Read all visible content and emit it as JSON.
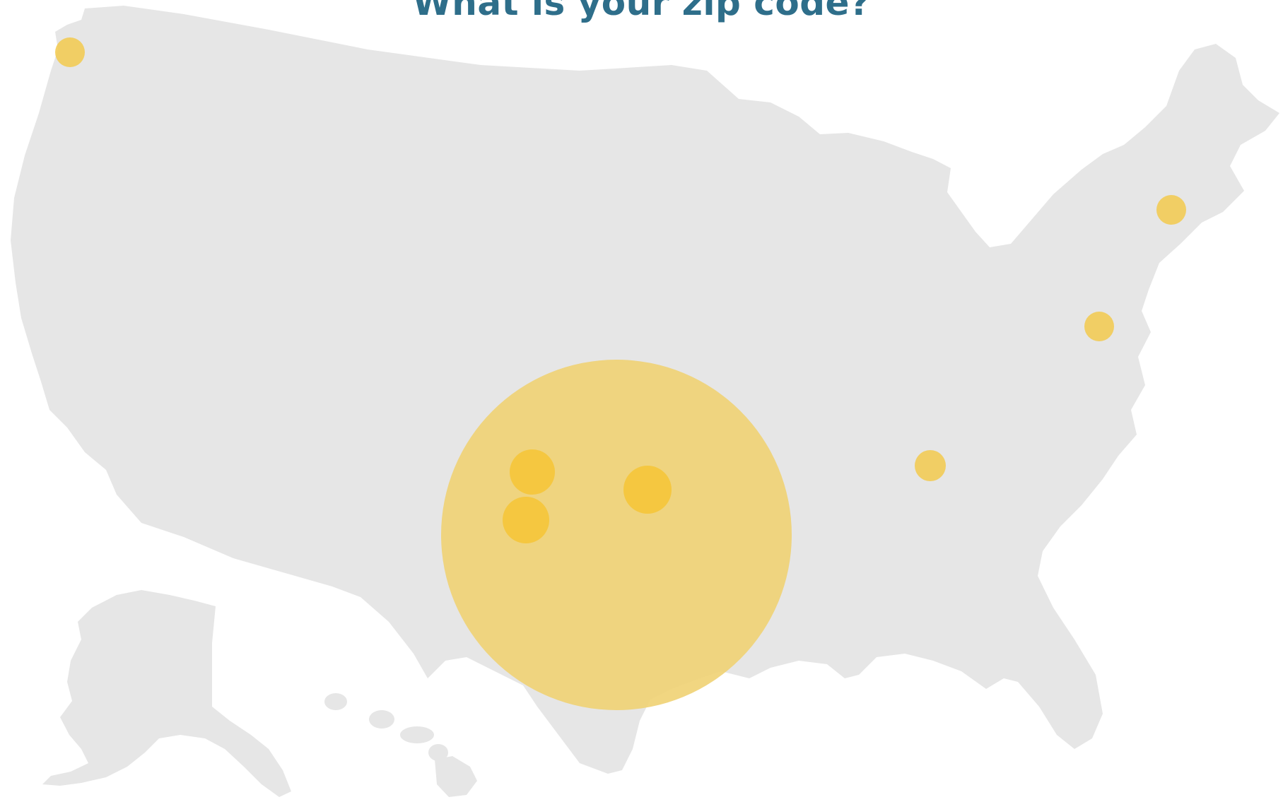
{
  "question": {
    "text": "What is your zip code?"
  },
  "colors": {
    "title": "#2e6e8a",
    "land": "#e6e6e6",
    "marker": "#f2c94c",
    "marker_strong": "#f5c53a",
    "highlight_zone": "#efd173"
  },
  "map": {
    "region": "United States",
    "parts": [
      "contiguous-us",
      "alaska",
      "hawaii"
    ],
    "markers": [
      {
        "id": "seattle-area",
        "size": "small"
      },
      {
        "id": "new-england",
        "size": "small"
      },
      {
        "id": "mid-atlantic",
        "size": "small"
      },
      {
        "id": "tennessee-area",
        "size": "small"
      },
      {
        "id": "texas-west-1",
        "size": "medium"
      },
      {
        "id": "texas-west-2",
        "size": "medium"
      },
      {
        "id": "texas-east",
        "size": "medium"
      },
      {
        "id": "texas-region",
        "size": "large"
      }
    ]
  }
}
